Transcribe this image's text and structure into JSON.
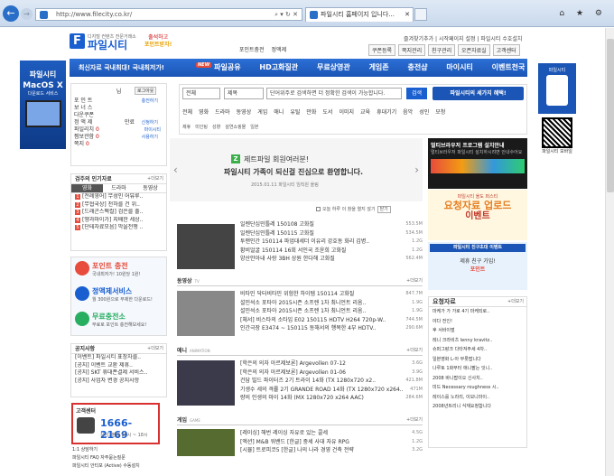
{
  "browser": {
    "url": "http://www.filecity.co.kr/",
    "addr_controls": "⌕ ▾ ↻ ✕",
    "tab_title": "파일시티 홈페이지 입니다...",
    "tab_close": "✕",
    "back": "←",
    "forward": "→",
    "tools": "⌂ ★ ⚙"
  },
  "site": {
    "logo_letter": "F",
    "tagline": "디지털 컨텐츠 전문거래소",
    "name": "파일시티",
    "promo_line1": "출석하고",
    "promo_line2": "포인트받자!",
    "toplinks": "즐겨찾기추가 | 시작페이지 설정 | 파일시티 수호설치",
    "header_buttons": [
      "포인트충전",
      "정액제",
      "쿠폰등록",
      "쪽지관리",
      "친구관리",
      "오픈자료실",
      "고객센터"
    ]
  },
  "nav": {
    "first": "최신자료 국내최대! 국내최저가!",
    "new_badge": "NEW",
    "items": [
      "파일공유",
      "HD고화질관",
      "무료상영관",
      "게임존",
      "충전샵",
      "마이시티",
      "이벤트천국"
    ]
  },
  "left_ad": {
    "brand": "파일시티",
    "title": "MacOS X",
    "sub": "다운로드 서비스"
  },
  "right_ad": {
    "label": "파일시티",
    "qr_label": "파일시티 모바일"
  },
  "login": {
    "name": "님",
    "logout": "로그아웃",
    "rows": [
      {
        "label": "포 인 트",
        "value": "충전하기"
      },
      {
        "label": "보 너 스",
        "value": ""
      },
      {
        "label": "다운쿠폰",
        "value": ""
      },
      {
        "label": "정 액 제",
        "value": "신청하기"
      },
      {
        "label": "파일리치",
        "value": "0"
      },
      {
        "label": "찜보관함",
        "value": "0"
      },
      {
        "label": "쪽지",
        "value": "0"
      }
    ],
    "mypage": "마이시티",
    "storage": "만료",
    "charge": "사용하기"
  },
  "popular": {
    "title": "검주의 인기자료",
    "more": "+더보기",
    "tabs": [
      "영화",
      "드라마",
      "동영상"
    ],
    "items": [
      "[전례영어] 무성인 어뷰루..",
      "[무협국상] 천하를 건 위..",
      "[드래곤스펙컬] 검은를 출..",
      "[땡과마이가] 지배한 세상..",
      "[단테자료모음] 막을전쟁 .."
    ]
  },
  "services": [
    {
      "title": "포인트 충전",
      "desc": "국내최저가! 10원당 1원!"
    },
    {
      "title": "정액제서비스",
      "desc": "월 300원으로 무제한 다운로드!"
    },
    {
      "title": "무료충전소",
      "desc": "무료로 포인트 충전해보세요!"
    }
  ],
  "notice": {
    "title": "공지사항",
    "more": "+더보기",
    "items": [
      "[이벤트] 파일시티 표창자를..",
      "[공지] 이벤트 교환 제휴..",
      "[공지] SKT 휴대폰결제 서비스..",
      "[공지] 사업자 변경 공지사항"
    ]
  },
  "customer": {
    "title": "고객센터",
    "phone": "1666-2169",
    "hours": "상담: 평일 10시 ~ 18시"
  },
  "bottom_links": [
    "1:1 상담하기",
    "파일시티 FAQ 자주묻는질문",
    "파일시티 안티포 (Active) 수동설치"
  ],
  "search": {
    "sel1": "전체",
    "sel2": "제목",
    "placeholder": "단어위주로 검색하면 더 정확한 검색이 가능합니다.",
    "button": "검색",
    "banner": "파일시티의 세가지 혜택!",
    "cats": [
      "전체",
      "영화",
      "드라마",
      "동영상",
      "게임",
      "애니",
      "유틸",
      "만화",
      "도서",
      "이미지",
      "교육",
      "휴대기기",
      "음악",
      "성인",
      "모청"
    ],
    "cats2": [
      "제휴",
      "미인팅",
      "성향",
      "설연쇼핑몰",
      "일본"
    ]
  },
  "welcome": {
    "brand": "Z",
    "line1": "제트파일 회원여러분!",
    "line2": "파일시티 가족이 되신걸 진심으로 환영합니다.",
    "line3": "2015.01.11 파일시티 임직원 올림",
    "prev": "‹",
    "next": "›"
  },
  "daycheck": {
    "label": "오늘 하루 이 창을 열지 않기",
    "close": "닫기"
  },
  "sections": {
    "top_rows": [
      {
        "t": "일렌단심민틀레 150108 고화질",
        "s": "553.5M"
      },
      {
        "t": "일렌단심민틀레 150115 고화질",
        "s": "534.5M"
      },
      {
        "t": "투맨인간 150114 파업대세더 이유리 강호동 화리 김병..",
        "s": "1.2G"
      },
      {
        "t": "황비얼굴 150114 16회 서인국 조윤희 고화질",
        "s": "1.2G"
      },
      {
        "t": "양산안아내 사랑 3BH 상원 한다해 고화질",
        "s": "562.4M"
      }
    ],
    "video": {
      "title": "동영상",
      "tag": "TV",
      "more": "+더보기"
    },
    "video_rows": [
      {
        "t": "비타민 닥터비타민 위험한 하이템 150114 고화질",
        "s": "847.7M"
      },
      {
        "t": "설민석소 포타아 2015시즌 소프렌 1차 최니언트 리옴..",
        "s": "1.9G"
      },
      {
        "t": "설민석소 포타아 2015시즌 소프렌 1차 최니언트 리옴..",
        "s": "1.9G"
      },
      {
        "t": "[체서] 비스타의 소타입 E02 150115 HDTV H264 720p-W..",
        "s": "744.5M"
      },
      {
        "t": "인간극장 E3474 ~ 150115 동해서의 행복한 4부 HDTV..",
        "s": "290.6M"
      }
    ],
    "anime": {
      "title": "애니",
      "tag": "ANIMATION",
      "more": "+더보기"
    },
    "anime_rows": [
      {
        "t": "[학은의 의자 아르제보론] Argevollen 07-12",
        "s": "3.6G"
      },
      {
        "t": "[학은의 의자 아르제보론] Argevollen 01-06",
        "s": "3.9G"
      },
      {
        "t": "건담 빌드 파이터즈 2기 트라이 14화 (TX 1280x720 x2..",
        "s": "421.8M"
      },
      {
        "t": "기생수 세의 격률 2기 GRANDE ROAD 14화 (TX 1280x720 x264..",
        "s": "471M"
      },
      {
        "t": "량의 인생의 마이 14화 (MX 1280x720 x264 AAC)",
        "s": "284.6M"
      }
    ],
    "game": {
      "title": "게임",
      "tag": "GAME",
      "more": "+더보기"
    },
    "game_rows": [
      {
        "t": "[레이싱] 해번 레이싱 자유로 있는 콜세",
        "s": "4.5G"
      },
      {
        "t": "[액션] M&B 워밴드 [한글] 중세 사대 자유 RPG",
        "s": "1.2G"
      },
      {
        "t": "[시뮬] 트로피코5 [한글] 나의 나라 경영 건축 전략",
        "s": "3.2G"
      },
      {
        "t": "[액션] 대스트An Elysian Tail 한글 액션 활형 액션",
        "s": "1.2G"
      },
      {
        "t": "[퍼즐] Papo yo [한글] 퍼즐 스토리",
        "s": "2.2G"
      }
    ]
  },
  "right": {
    "ad1_title": "멀티브라우저 프로그램 설치안내",
    "ad1_sub": "멀티브라우저 파일시티 설치하시려면 안내수어요",
    "ad2_small": "파일시티 올도 퍼스티",
    "ad2_big1": "요청자료 업로드",
    "ad2_big2": "이벤트",
    "ad3_title": "파일시티 친구초대 이벤트",
    "ad3_line1": "제휴 친구 가입!",
    "ad3_line2": "포인트",
    "request_title": "요청자료",
    "request_more": "+더보기",
    "requests": [
      "마케가 가 가로 4기 마케되로..",
      "야다 전인!",
      "후 서바이벌",
      "레니 크라비츠 lenny kravitz..",
      "슈퍼그랑크 다타져주세 4차..",
      "일본영화 L-아 무릇팝니다",
      "나루토 1화부터 애니팔는 잇니..",
      "2008 바니팝이오 신사치..",
      "미드 Necessary roughness 시..",
      "레이스를 노라리, 이모니마이..",
      "2008년트리니 식재요청합니다"
    ]
  }
}
